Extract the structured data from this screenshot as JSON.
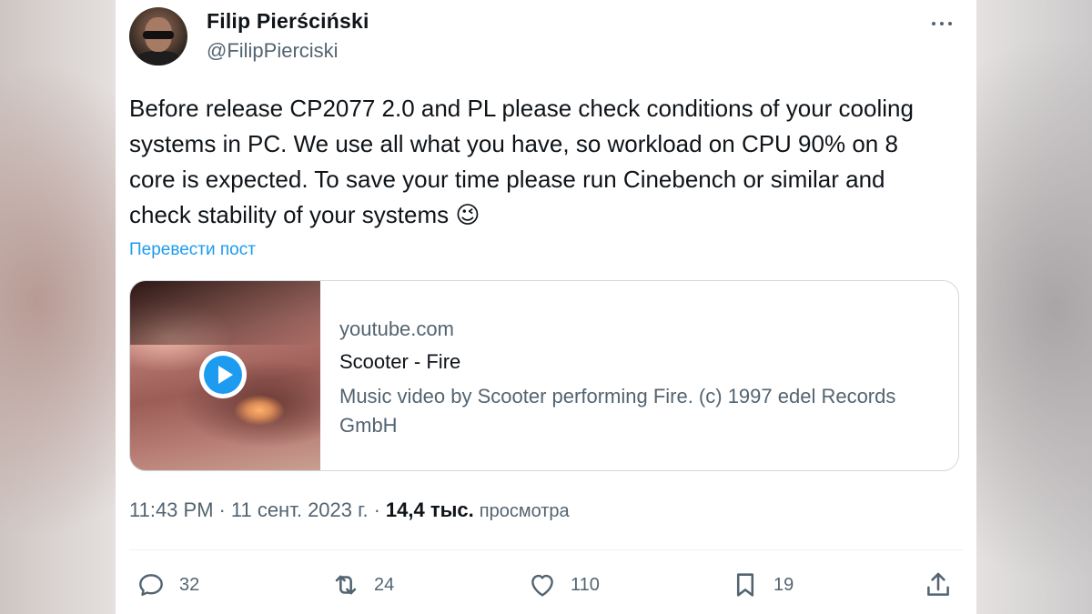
{
  "author": {
    "name": "Filip Pierściński",
    "handle": "@FilipPierciski"
  },
  "tweet": {
    "text": "Before release CP2077 2.0 and PL please check conditions of your cooling systems in PC. We use all what you have, so workload on CPU 90% on 8 core is expected. To save your time please run Cinebench or similar and check stability of your systems 😉",
    "translate_label": "Перевести пост"
  },
  "link_card": {
    "domain": "youtube.com",
    "title": "Scooter - Fire",
    "description": "Music video by Scooter performing Fire. (c) 1997 edel Records GmbH"
  },
  "meta": {
    "time": "11:43 PM",
    "separator": "·",
    "date": "11 сент. 2023 г.",
    "views_count": "14,4 тыс.",
    "views_label": "просмотра"
  },
  "actions": {
    "replies": "32",
    "reposts": "24",
    "likes": "110",
    "bookmarks": "19"
  },
  "colors": {
    "accent": "#1d9bf0",
    "text_primary": "#0f1419",
    "text_secondary": "#536471",
    "border": "#cfd9de"
  },
  "icons": [
    "more-dots-icon",
    "play-icon",
    "reply-icon",
    "repost-icon",
    "like-icon",
    "bookmark-icon",
    "share-icon"
  ]
}
